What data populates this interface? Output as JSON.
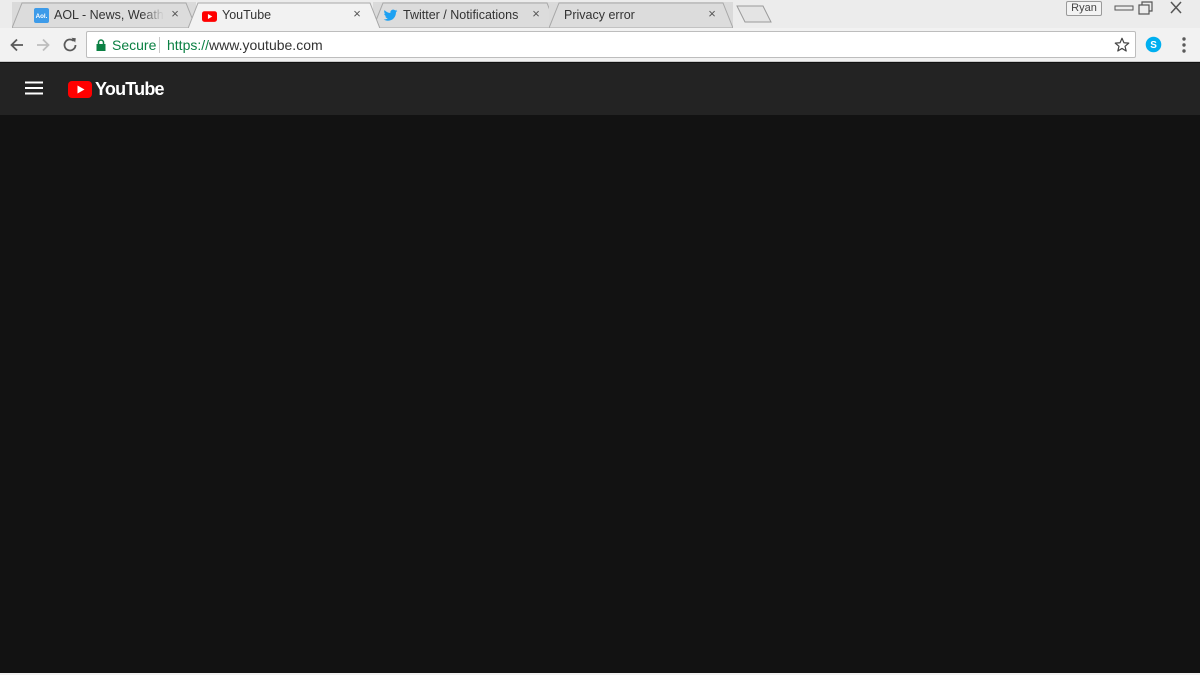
{
  "browser": {
    "tabs": [
      {
        "title": "AOL - News, Weather, Entertainment",
        "favicon": "aol-icon",
        "active": false
      },
      {
        "title": "YouTube",
        "favicon": "youtube-icon",
        "active": true
      },
      {
        "title": "Twitter / Notifications",
        "favicon": "twitter-icon",
        "active": false
      },
      {
        "title": "Privacy error",
        "favicon": "none",
        "active": false
      }
    ],
    "close_glyph": "×",
    "profile_name": "Ryan",
    "omnibox": {
      "security_label": "Secure",
      "url_scheme": "https://",
      "url_rest": "www.youtube.com"
    },
    "aol_badge": "Aol."
  },
  "youtube": {
    "logo_text": "YouTube"
  },
  "colors": {
    "youtube_red": "#ff0000",
    "secure_green": "#0b8043",
    "masthead_bg": "#232323",
    "page_bg": "#121212",
    "twitter_blue": "#1da1f2",
    "skype_blue": "#00aff0",
    "aol_blue": "#3d9be9"
  }
}
